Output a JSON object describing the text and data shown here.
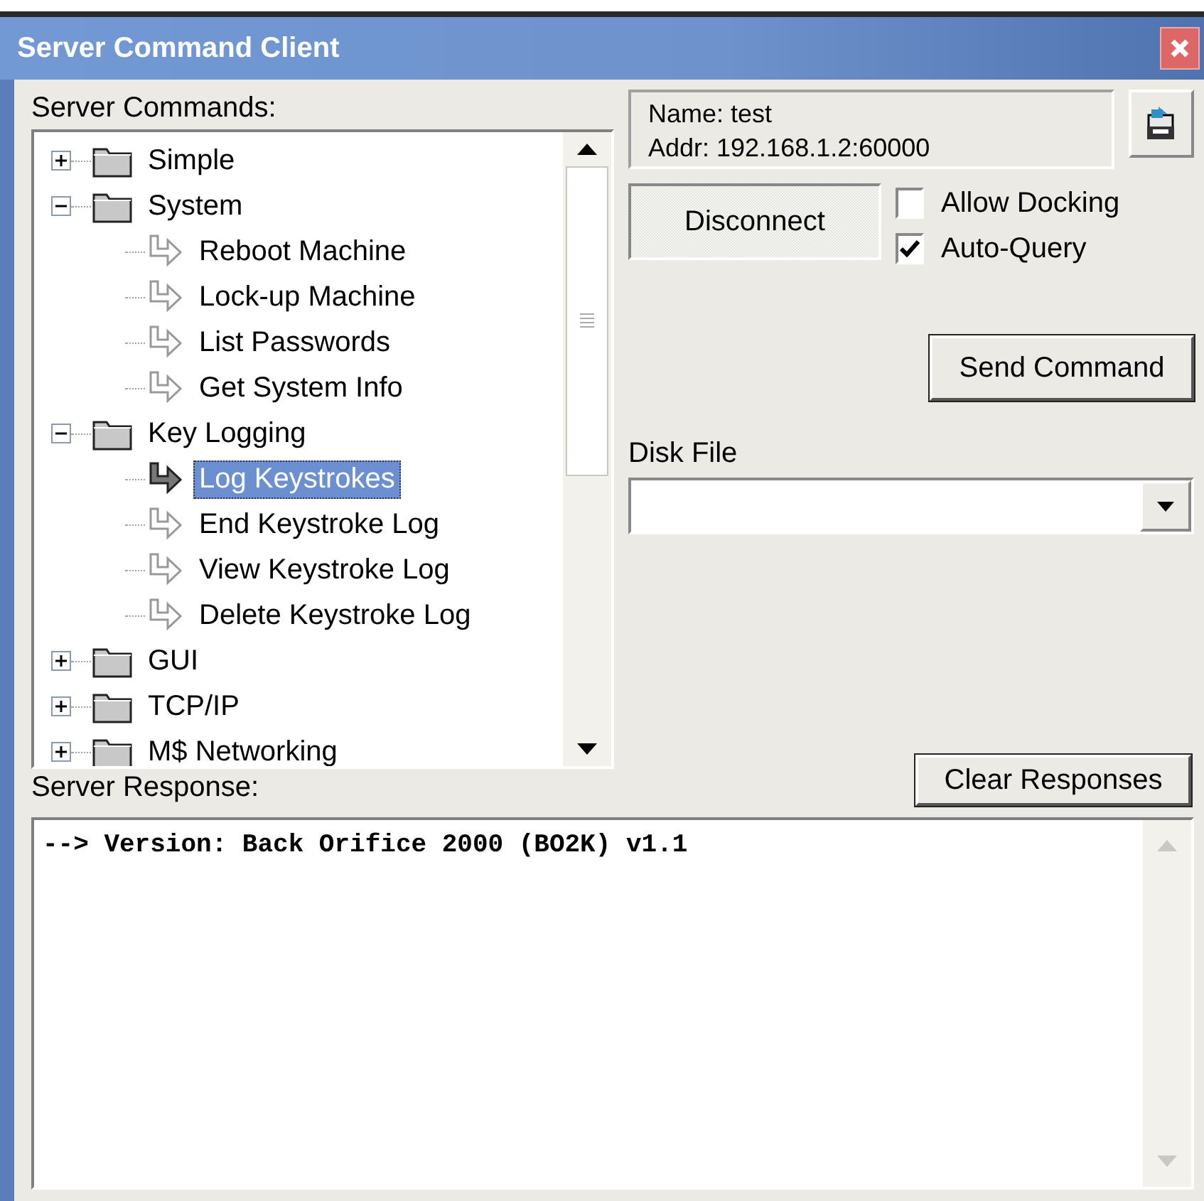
{
  "window": {
    "title": "Server Command Client"
  },
  "commands": {
    "label": "Server Commands:",
    "tree": [
      {
        "label": "Simple",
        "kind": "folder",
        "expanded": false,
        "selected": false
      },
      {
        "label": "System",
        "kind": "folder",
        "expanded": true,
        "selected": false,
        "children": [
          {
            "label": "Reboot Machine",
            "kind": "command",
            "selected": false
          },
          {
            "label": "Lock-up Machine",
            "kind": "command",
            "selected": false
          },
          {
            "label": "List Passwords",
            "kind": "command",
            "selected": false
          },
          {
            "label": "Get System Info",
            "kind": "command",
            "selected": false
          }
        ]
      },
      {
        "label": "Key Logging",
        "kind": "folder",
        "expanded": true,
        "selected": false,
        "children": [
          {
            "label": "Log Keystrokes",
            "kind": "command",
            "selected": true
          },
          {
            "label": "End Keystroke Log",
            "kind": "command",
            "selected": false
          },
          {
            "label": "View Keystroke Log",
            "kind": "command",
            "selected": false
          },
          {
            "label": "Delete Keystroke Log",
            "kind": "command",
            "selected": false
          }
        ]
      },
      {
        "label": "GUI",
        "kind": "folder",
        "expanded": false,
        "selected": false
      },
      {
        "label": "TCP/IP",
        "kind": "folder",
        "expanded": false,
        "selected": false
      },
      {
        "label": "M$ Networking",
        "kind": "folder",
        "expanded": false,
        "selected": false
      }
    ]
  },
  "server": {
    "name": "Name: test",
    "addr": "Addr: 192.168.1.2:60000"
  },
  "disconnect": {
    "label": "Disconnect",
    "pressed": true
  },
  "options": [
    {
      "label": "Allow Docking",
      "checked": false
    },
    {
      "label": "Auto-Query",
      "checked": true
    }
  ],
  "send_command": {
    "label": "Send Command"
  },
  "disk_file": {
    "label": "Disk File"
  },
  "clear_responses": {
    "label": "Clear Responses"
  },
  "response": {
    "label": "Server Response:",
    "lines": [
      "--> Version: Back Orifice 2000 (BO2K) v1.1"
    ]
  }
}
